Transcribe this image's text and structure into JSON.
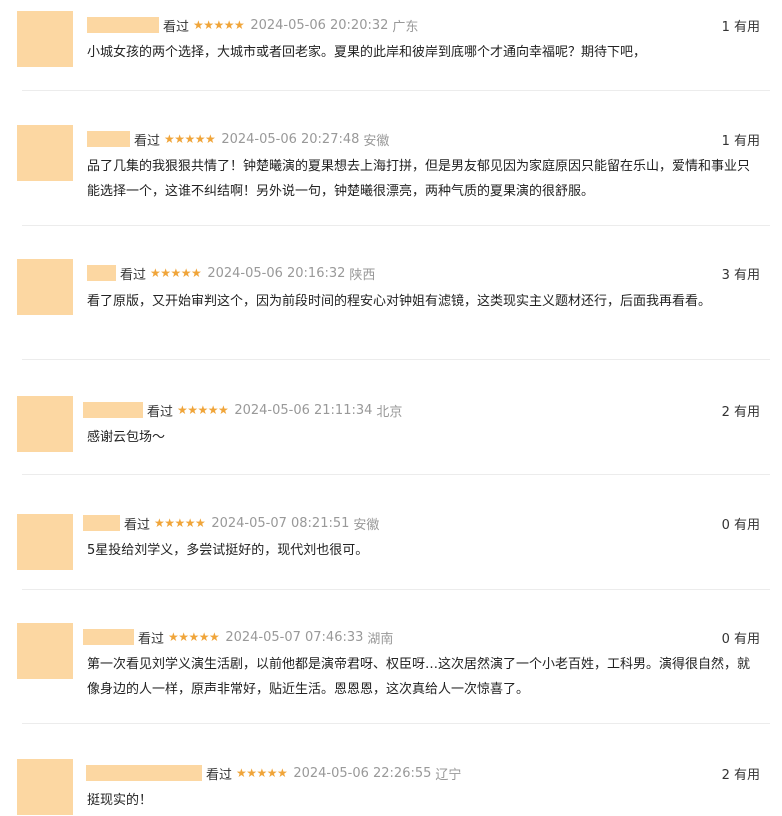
{
  "colors": {
    "avatar_placeholder": "#fcd7a2",
    "star": "#f0a53a",
    "meta_gray": "#999999"
  },
  "icons": {
    "star_glyph": "star-icon"
  },
  "comments": [
    {
      "status": "看过",
      "stars": "★★★★★",
      "time": "2024-05-06 20:20:32",
      "location": "广东",
      "useful": "1 有用",
      "content": "小城女孩的两个选择，大城市或者回老家。夏果的此岸和彼岸到底哪个才通向幸福呢？期待下吧，"
    },
    {
      "status": "看过",
      "stars": "★★★★★",
      "time": "2024-05-06 20:27:48",
      "location": "安徽",
      "useful": "1 有用",
      "content": "品了几集的我狠狠共情了！钟楚曦演的夏果想去上海打拼，但是男友郁见因为家庭原因只能留在乐山，爱情和事业只能选择一个，这谁不纠结啊！另外说一句，钟楚曦很漂亮，两种气质的夏果演的很舒服。"
    },
    {
      "status": "看过",
      "stars": "★★★★★",
      "time": "2024-05-06 20:16:32",
      "location": "陕西",
      "useful": "3 有用",
      "content": "看了原版，又开始审判这个，因为前段时间的程安心对钟姐有滤镜，这类现实主义题材还行，后面我再看看。"
    },
    {
      "status": "看过",
      "stars": "★★★★★",
      "time": "2024-05-06 21:11:34",
      "location": "北京",
      "useful": "2 有用",
      "content": "感谢云包场～"
    },
    {
      "status": "看过",
      "stars": "★★★★★",
      "time": "2024-05-07 08:21:51",
      "location": "安徽",
      "useful": "0 有用",
      "content": "5星投给刘学义，多尝试挺好的，现代刘也很可。"
    },
    {
      "status": "看过",
      "stars": "★★★★★",
      "time": "2024-05-07 07:46:33",
      "location": "湖南",
      "useful": "0 有用",
      "content": "第一次看见刘学义演生活剧，以前他都是演帝君呀、权臣呀…这次居然演了一个小老百姓，工科男。演得很自然，就像身边的人一样，原声非常好，贴近生活。恩恩恩，这次真给人一次惊喜了。"
    },
    {
      "status": "看过",
      "stars": "★★★★★",
      "time": "2024-05-06 22:26:55",
      "location": "辽宁",
      "useful": "2 有用",
      "content": "挺现实的！"
    }
  ]
}
